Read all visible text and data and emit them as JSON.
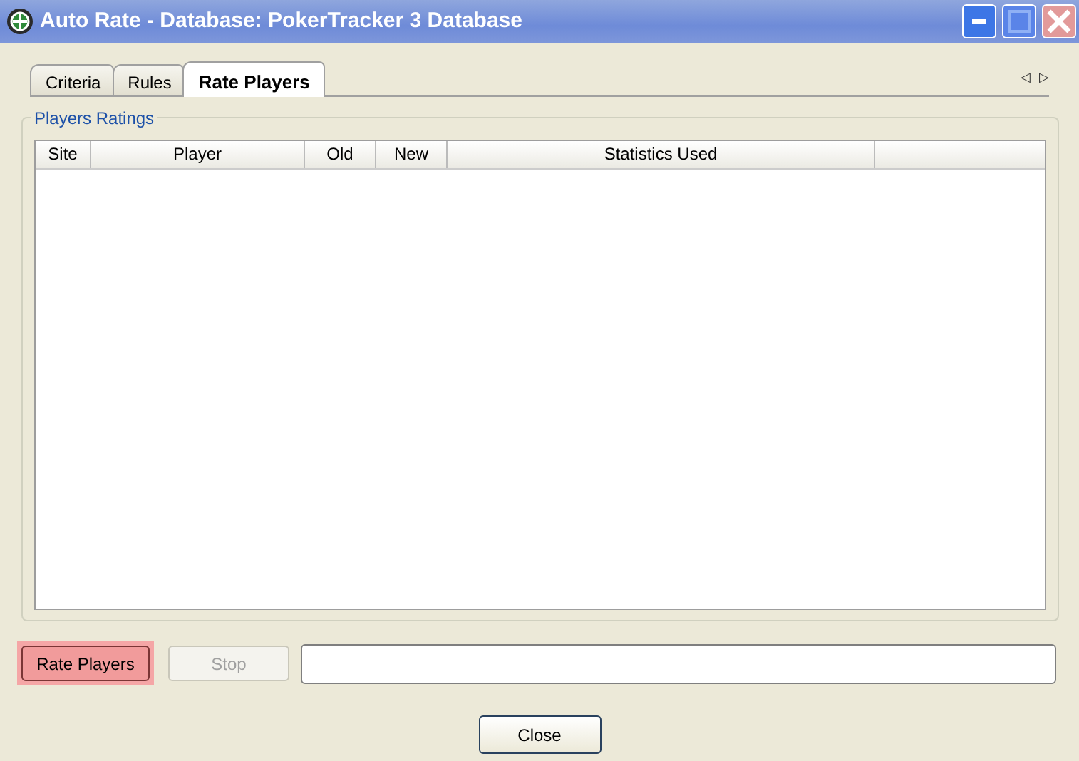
{
  "window": {
    "title": "Auto Rate - Database: PokerTracker 3 Database"
  },
  "tabs": [
    {
      "label": "Criteria",
      "selected": false
    },
    {
      "label": "Rules",
      "selected": false
    },
    {
      "label": "Rate Players",
      "selected": true
    }
  ],
  "tab_scroll": [
    "◁",
    "▷"
  ],
  "group": {
    "title": "Players Ratings"
  },
  "table": {
    "columns": [
      "Site",
      "Player",
      "Old",
      "New",
      "Statistics Used"
    ]
  },
  "buttons": [
    {
      "label": "Rate Players",
      "disabled": false,
      "highlighted": true
    },
    {
      "label": "Stop",
      "disabled": true,
      "highlighted": false
    }
  ],
  "close_button": {
    "label": "Close"
  }
}
